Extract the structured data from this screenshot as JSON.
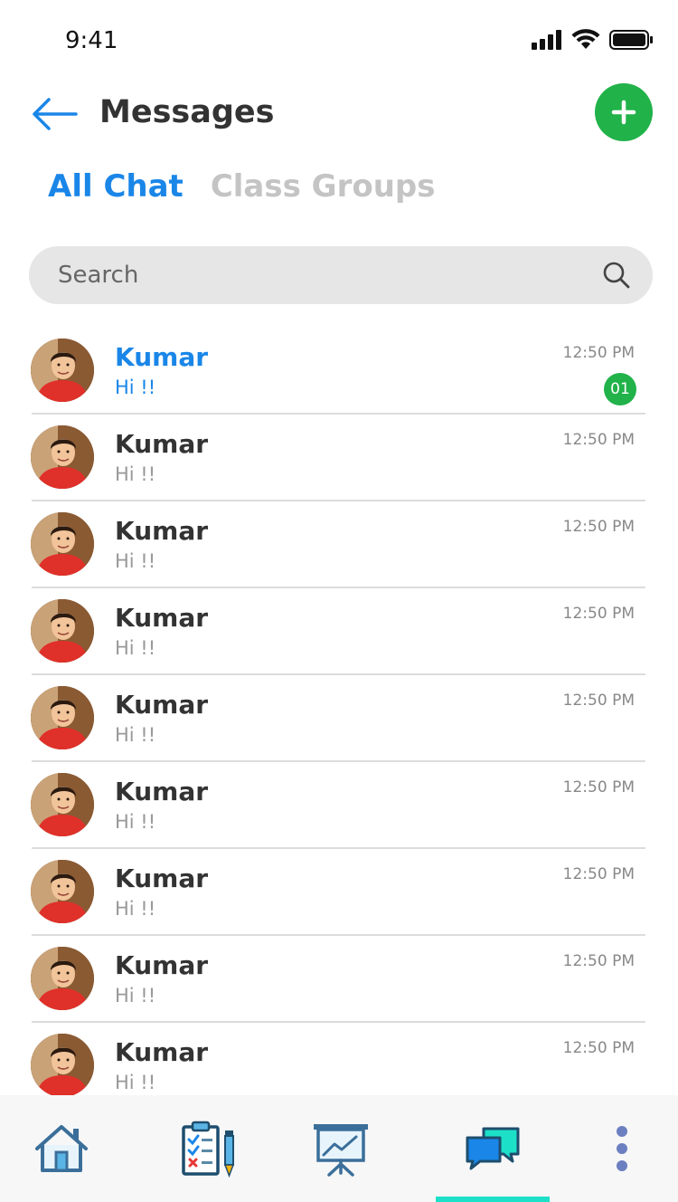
{
  "status_bar": {
    "time": "9:41"
  },
  "header": {
    "title": "Messages"
  },
  "tabs": [
    {
      "label": "All Chat",
      "active": true
    },
    {
      "label": "Class Groups",
      "active": false
    }
  ],
  "search": {
    "placeholder": "Search",
    "value": ""
  },
  "chats": [
    {
      "name": "Kumar",
      "preview": "Hi !!",
      "time": "12:50 PM",
      "unread_count": "01",
      "unread": true
    },
    {
      "name": "Kumar",
      "preview": "Hi !!",
      "time": "12:50 PM",
      "unread": false
    },
    {
      "name": "Kumar",
      "preview": "Hi !!",
      "time": "12:50 PM",
      "unread": false
    },
    {
      "name": "Kumar",
      "preview": "Hi !!",
      "time": "12:50 PM",
      "unread": false
    },
    {
      "name": "Kumar",
      "preview": "Hi !!",
      "time": "12:50 PM",
      "unread": false
    },
    {
      "name": "Kumar",
      "preview": "Hi !!",
      "time": "12:50 PM",
      "unread": false
    },
    {
      "name": "Kumar",
      "preview": "Hi !!",
      "time": "12:50 PM",
      "unread": false
    },
    {
      "name": "Kumar",
      "preview": "Hi !!",
      "time": "12:50 PM",
      "unread": false
    },
    {
      "name": "Kumar",
      "preview": "Hi !!",
      "time": "12:50 PM",
      "unread": false
    }
  ],
  "bottom_nav": [
    {
      "icon": "home-icon"
    },
    {
      "icon": "checklist-icon"
    },
    {
      "icon": "presentation-icon"
    },
    {
      "icon": "chat-icon",
      "active": true
    },
    {
      "icon": "more-vertical-icon"
    }
  ],
  "colors": {
    "accent": "#1a86e8",
    "green": "#21b24a",
    "tab_indicator": "#1de0c8",
    "inactive_tab": "#c4c4c4"
  }
}
